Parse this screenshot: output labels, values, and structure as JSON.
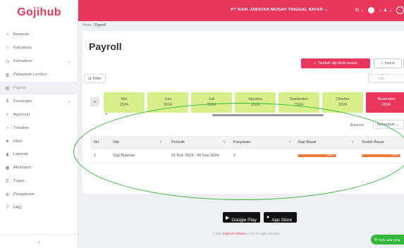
{
  "app": {
    "logo": "Gojihub"
  },
  "sidebar": {
    "items": [
      {
        "label": "Beranda",
        "icon": "home-icon"
      },
      {
        "label": "Karyawan",
        "icon": "users-icon"
      },
      {
        "label": "Kehadiran",
        "icon": "clock-icon",
        "expandable": true
      },
      {
        "label": "Pelaporan Lembur",
        "icon": "chart-icon"
      },
      {
        "label": "Payroll",
        "icon": "payroll-icon",
        "active": true
      },
      {
        "label": "Keuangan",
        "icon": "finance-icon",
        "expandable": true
      },
      {
        "label": "Approval",
        "icon": "approval-icon"
      },
      {
        "label": "Timeline",
        "icon": "timeline-icon"
      },
      {
        "label": "Klien",
        "icon": "client-icon"
      },
      {
        "label": "Laporan",
        "icon": "report-icon"
      },
      {
        "label": "Akuntansi",
        "icon": "accounting-icon"
      },
      {
        "label": "Tugas",
        "icon": "task-icon"
      },
      {
        "label": "Pengaturan",
        "icon": "settings-icon"
      },
      {
        "label": "FAQ",
        "icon": "help-icon"
      }
    ],
    "collapse_glyph": "‹"
  },
  "topbar": {
    "company": "PT NAIK JABATAN MUDAH TINGGAL BAYAR",
    "lang": "ID",
    "accent": "#e8365d"
  },
  "breadcrumb": {
    "home": "Home",
    "sep": "/",
    "current": "Payroll"
  },
  "main": {
    "title": "Payroll",
    "create_label": "Tambah slip disini masuk",
    "import_label": "Import",
    "filter_label": "Filter",
    "search_placeholder": "Cari"
  },
  "months": [
    {
      "name": "Mei",
      "year": "2024"
    },
    {
      "name": "Juni",
      "year": "2024"
    },
    {
      "name": "Juli",
      "year": "2024"
    },
    {
      "name": "Agustus",
      "year": "2024"
    },
    {
      "name": "September",
      "year": "2024"
    },
    {
      "name": "Oktober",
      "year": "2024"
    },
    {
      "name": "November",
      "year": "2024",
      "selected": true
    }
  ],
  "month_filter": {
    "label": "Bulan ini",
    "value": "November"
  },
  "table": {
    "headers": [
      "No.",
      "Slip",
      "Periode",
      "Karyawan",
      "Siap Bayar",
      "Sudah Bayar"
    ],
    "rows": [
      {
        "no": "1",
        "slip": "Gaji Bulanan",
        "periode": "01 Nov 2024 - 30 Nov 2024",
        "karyawan": "2",
        "siap_bayar": 100,
        "sudah_bayar": 100
      }
    ]
  },
  "footer": {
    "google_play_small": "GET IT ON",
    "google_play": "Google Play",
    "app_store_small": "Download on the",
    "app_store": "App Store",
    "copyright_prefix": "© 2024",
    "copyright_brand": "Gojitech Software",
    "copyright_suffix": "v1.2.0 All rights reserved"
  },
  "chat": {
    "label": "Halo, ada yang"
  },
  "colors": {
    "accent": "#e8365d",
    "month": "#d7f08a",
    "highlight": "#33b83a",
    "progress": "#ee7a3a"
  }
}
